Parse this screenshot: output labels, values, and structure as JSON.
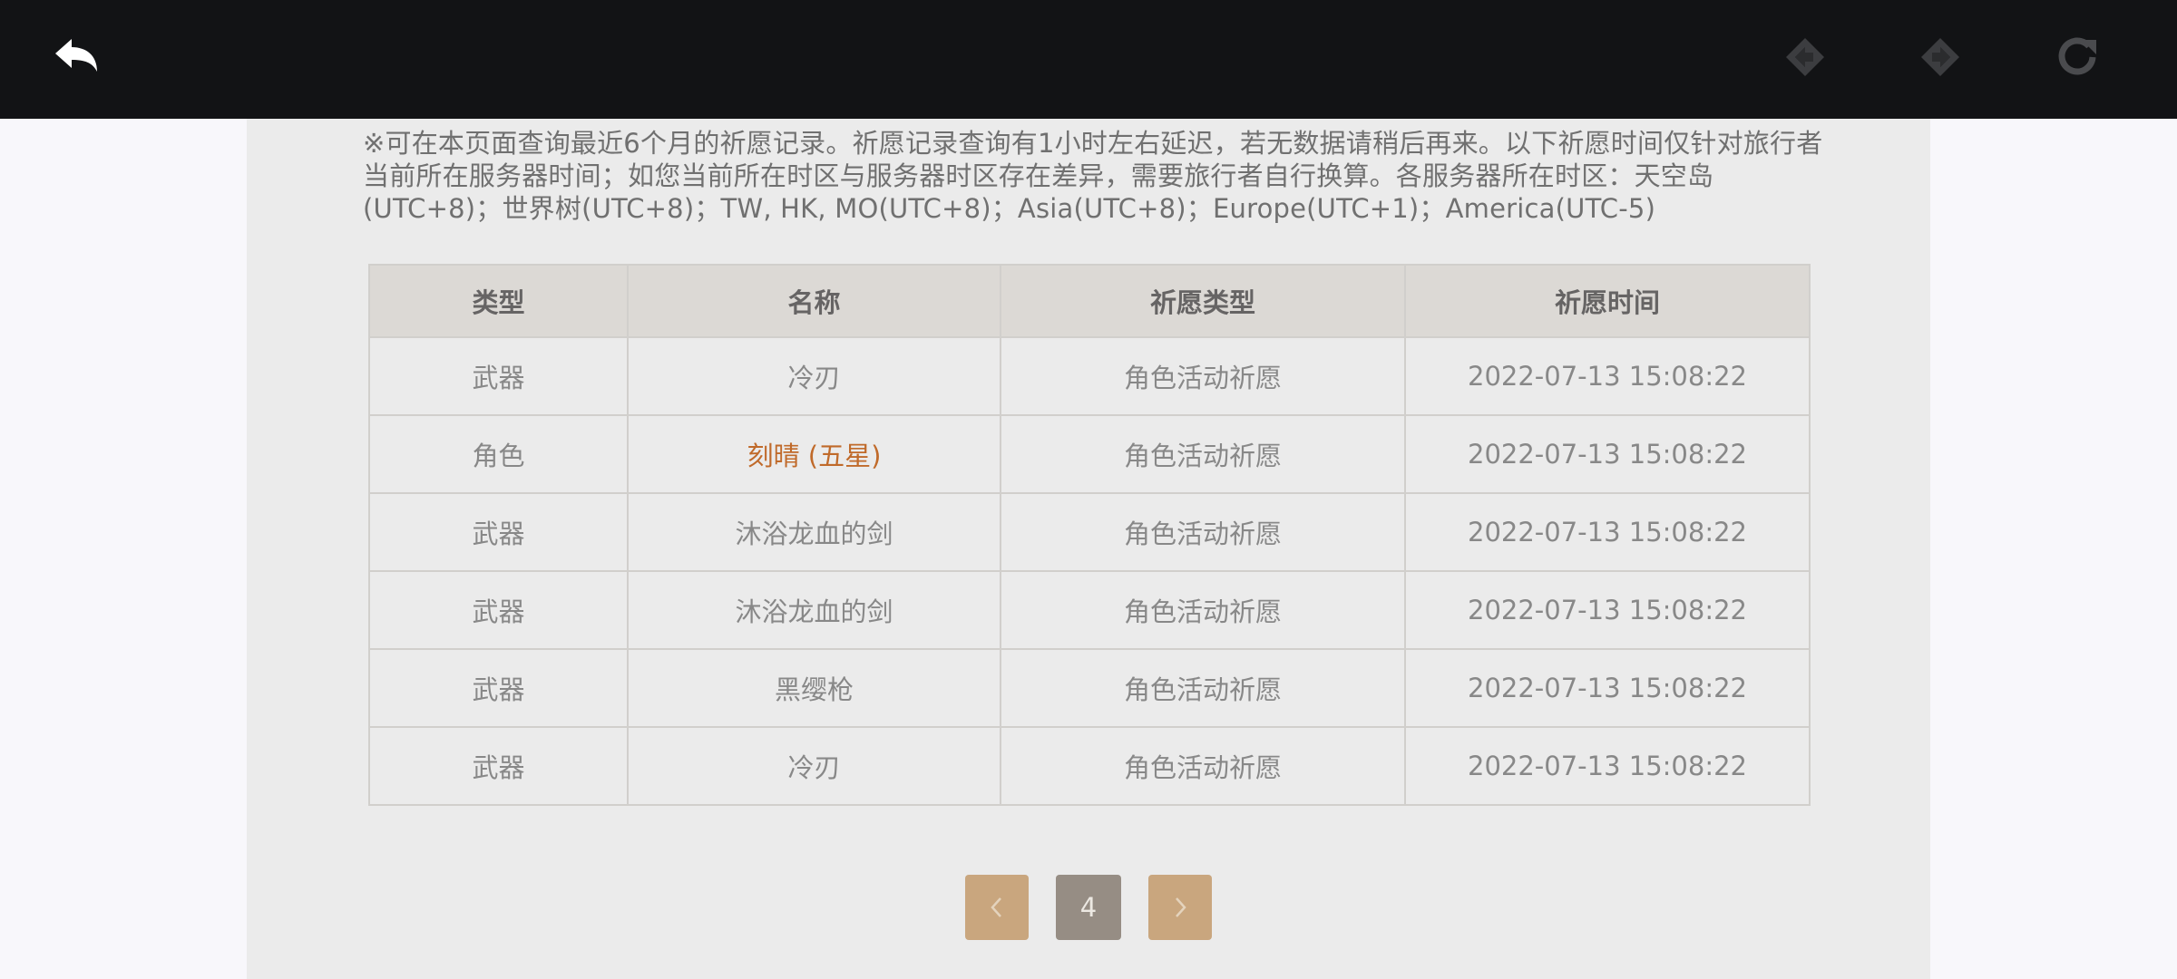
{
  "toolbar": {
    "back_icon": "back-arrow-icon",
    "prev_icon": "diamond-left-icon",
    "next_icon": "diamond-right-icon",
    "reload_icon": "reload-icon"
  },
  "notice": {
    "text": "※可在本页面查询最近6个月的祈愿记录。祈愿记录查询有1小时左右延迟，若无数据请稍后再来。以下祈愿时间仅针对旅行者当前所在服务器时间；如您当前所在时区与服务器时区存在差异，需要旅行者自行换算。各服务器所在时区：天空岛(UTC+8)；世界树(UTC+8)；TW, HK, MO(UTC+8)；Asia(UTC+8)；Europe(UTC+1)；America(UTC-5)"
  },
  "table": {
    "headers": [
      "类型",
      "名称",
      "祈愿类型",
      "祈愿时间"
    ],
    "rows": [
      {
        "type": "武器",
        "name": "冷刃",
        "wish_type": "角色活动祈愿",
        "time": "2022-07-13 15:08:22",
        "five_star": false
      },
      {
        "type": "角色",
        "name": "刻晴 (五星)",
        "wish_type": "角色活动祈愿",
        "time": "2022-07-13 15:08:22",
        "five_star": true
      },
      {
        "type": "武器",
        "name": "沐浴龙血的剑",
        "wish_type": "角色活动祈愿",
        "time": "2022-07-13 15:08:22",
        "five_star": false
      },
      {
        "type": "武器",
        "name": "沐浴龙血的剑",
        "wish_type": "角色活动祈愿",
        "time": "2022-07-13 15:08:22",
        "five_star": false
      },
      {
        "type": "武器",
        "name": "黑缨枪",
        "wish_type": "角色活动祈愿",
        "time": "2022-07-13 15:08:22",
        "five_star": false
      },
      {
        "type": "武器",
        "name": "冷刃",
        "wish_type": "角色活动祈愿",
        "time": "2022-07-13 15:08:22",
        "five_star": false
      }
    ],
    "five_star_color": "#c06a2a"
  },
  "pagination": {
    "prev_icon": "chevron-left-icon",
    "current_page": "4",
    "next_icon": "chevron-right-icon"
  },
  "colors": {
    "toolbar_bg": "#121315",
    "panel_bg": "#ebebeb",
    "header_bg": "#dcd9d5",
    "pager_button": "#c9a67e",
    "pager_current": "#968d84"
  }
}
